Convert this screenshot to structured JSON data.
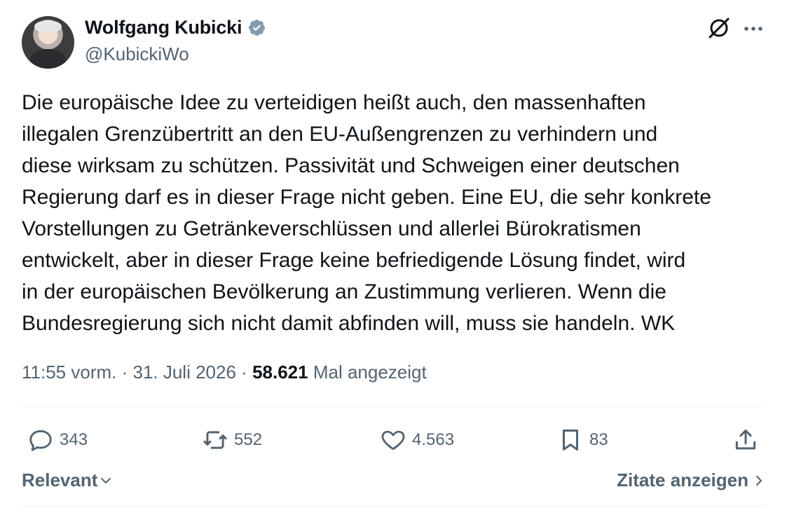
{
  "author": {
    "name": "Wolfgang Kubicki",
    "handle": "@KubickiWo",
    "verified_color": "#829aab"
  },
  "tweet": {
    "text": "Die europäische Idee zu verteidigen heißt auch, den massenhaften\nillegalen Grenzübertritt an den EU-Außengrenzen zu verhindern und\ndiese wirksam zu schützen. Passivität und Schweigen einer deutschen\nRegierung darf es in dieser Frage nicht geben. Eine EU, die sehr konkrete\nVorstellungen zu Getränkeverschlüssen und allerlei Bürokratismen\nentwickelt, aber in dieser Frage keine befriedigende Lösung findet, wird\nin der europäischen Bevölkerung an Zustimmung verlieren. Wenn die\nBundesregierung sich nicht damit abfinden will, muss sie handeln. WK",
    "time": "11:55 vorm.",
    "date": "31. Juli 2026",
    "views_count": "58.621",
    "views_label": "Mal angezeigt"
  },
  "actions": {
    "replies": "343",
    "reposts": "552",
    "likes": "4.563",
    "bookmarks": "83"
  },
  "footer": {
    "sort_label": "Relevant",
    "quotes_label": "Zitate anzeigen"
  },
  "icons": [
    "verified-badge-icon",
    "grok-icon",
    "more-icon",
    "reply-icon",
    "repost-icon",
    "like-icon",
    "bookmark-icon",
    "share-icon",
    "chevron-down-icon",
    "chevron-right-icon"
  ]
}
